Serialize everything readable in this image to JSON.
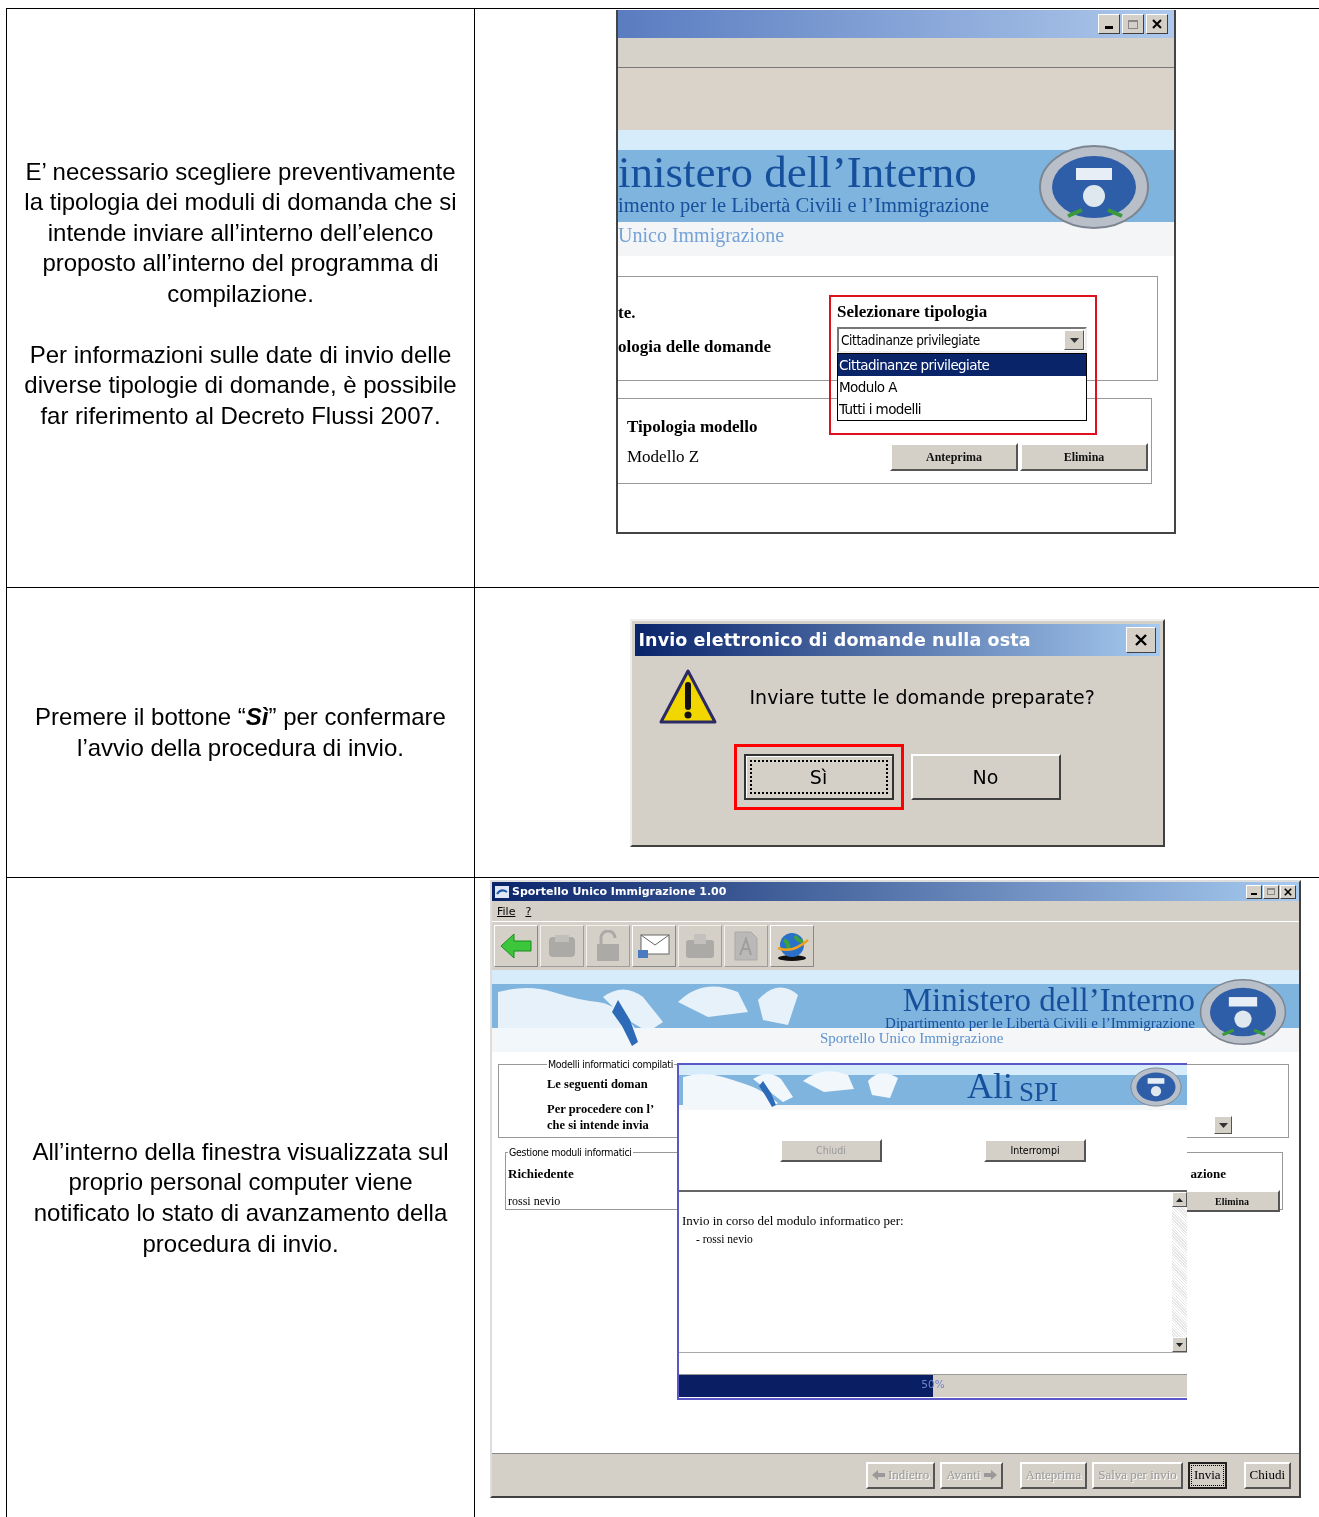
{
  "steps": [
    {
      "instruction": [
        "E’ necessario scegliere preventivamente la tipologia dei moduli di domanda che si intende inviare all’interno dell’elenco proposto all’interno del programma di compilazione.",
        "Per informazioni sulle date di invio delle diverse tipologie di domande, è possibile far riferimento al Decreto Flussi 2007."
      ],
      "screen": {
        "kind": "type_selection",
        "banner": {
          "title": "inistero dell’Interno",
          "subtitle": "imento per le Libertà Civili e l’Immigrazione",
          "caption": "Unico Immigrazione"
        },
        "labels": [
          "te.",
          "ologia delle domande"
        ],
        "selector": {
          "label": "Selezionare tipologia",
          "value": "Cittadinanze privilegiate",
          "options": [
            {
              "label": "Cittadinanze privilegiate",
              "selected": true
            },
            {
              "label": "Modulo A",
              "selected": false
            },
            {
              "label": "Tutti i modelli",
              "selected": false
            }
          ]
        },
        "models": {
          "header": "Tipologia modello",
          "rows": [
            {
              "name": "Modello Z",
              "buttons": [
                "Anteprima",
                "Elimina"
              ]
            }
          ]
        }
      }
    },
    {
      "instruction": [
        "Premere il bottone “**Sì**” per confermare l’avvio della procedura di invio."
      ],
      "screen": {
        "kind": "confirm_dialog",
        "title": "Invio elettronico di domande nulla osta",
        "message": "Inviare tutte le domande preparate?",
        "buttons": [
          {
            "label": "Sì",
            "highlighted": true
          },
          {
            "label": "No",
            "highlighted": false
          }
        ]
      }
    },
    {
      "instruction": [
        "All’interno della finestra visualizzata sul proprio personal computer viene notificato lo stato di avanzamento della procedura di invio."
      ],
      "screen": {
        "kind": "progress_window",
        "title": "Sportello Unico Immigrazione 1.00",
        "menu": [
          "File",
          "?"
        ],
        "toolbar": [
          {
            "kind": "back",
            "disabled": false
          },
          {
            "kind": "disk",
            "disabled": true
          },
          {
            "kind": "lock",
            "disabled": true
          },
          {
            "kind": "mail",
            "disabled": false
          },
          {
            "kind": "tray",
            "disabled": true
          },
          {
            "kind": "document",
            "disabled": true
          },
          {
            "kind": "globe",
            "disabled": false
          }
        ],
        "banner": {
          "title": "Ministero dell’Interno",
          "subtitle": "Dipartimento per le Libertà Civili e l’Immigrazione",
          "caption": "Sportello Unico Immigrazione"
        },
        "compiled": {
          "legend": "Modelli informatici compilati",
          "lines": [
            "Le seguenti doman",
            "Per procedere con l’",
            "che si intende invia"
          ]
        },
        "management": {
          "legend": "Gestione moduli informatici",
          "header": "Richiedente",
          "header_2": "azione",
          "rows": [
            {
              "name": "rossi nevio",
              "button": "Elimina"
            }
          ]
        },
        "progress_dialog": {
          "brand": "Ali",
          "brand_suffix": "SPI",
          "buttons": [
            {
              "label": "Chiudi",
              "disabled": true
            },
            {
              "label": "Interrompi",
              "disabled": false
            }
          ],
          "log": [
            "Invio in corso del modulo informatico per:",
            "- rossi nevio"
          ],
          "progress": {
            "level": 0.5,
            "reading": "50%"
          }
        },
        "footer": [
          {
            "label": "Indietro",
            "kind": "back",
            "disabled": true,
            "focused": false
          },
          {
            "label": "Avanti",
            "kind": "next",
            "disabled": true,
            "focused": false
          },
          {
            "label": "Anteprima",
            "kind": "plain",
            "disabled": true,
            "focused": false
          },
          {
            "label": "Salva per invio",
            "kind": "plain",
            "disabled": true,
            "focused": false
          },
          {
            "label": "Invia",
            "kind": "plain",
            "disabled": false,
            "focused": true
          },
          {
            "label": "Chiudi",
            "kind": "plain",
            "disabled": false,
            "focused": false
          }
        ]
      }
    }
  ]
}
